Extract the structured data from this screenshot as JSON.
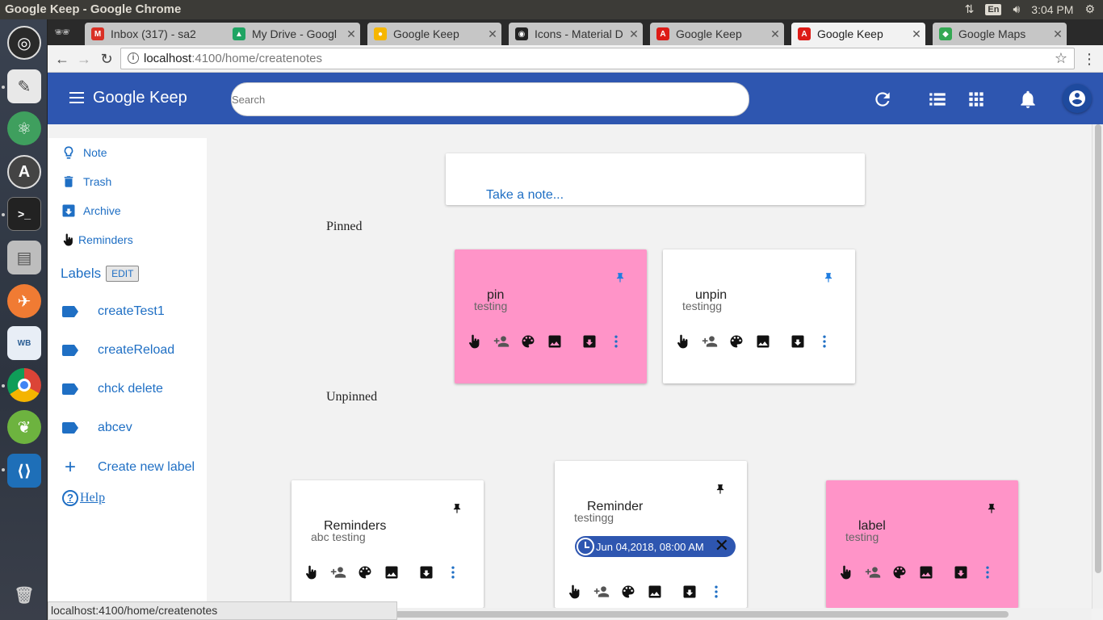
{
  "os": {
    "window_title": "Google Keep - Google Chrome",
    "lang": "En",
    "time": "3:04 PM"
  },
  "browser": {
    "tabs": [
      {
        "label": "Inbox (317) - sa2",
        "color": "#d93025"
      },
      {
        "label": "My Drive - Googl",
        "color": "#1fa463"
      },
      {
        "label": "Google Keep",
        "color": "#f6b600"
      },
      {
        "label": "Icons - Material D",
        "color": "#222222"
      },
      {
        "label": "Google Keep",
        "color": "#dd1b16"
      },
      {
        "label": "Google Keep",
        "color": "#dd1b16",
        "active": true
      },
      {
        "label": "Google Maps",
        "color": "#34a853"
      }
    ],
    "url_host": "localhost",
    "url_path": ":4100/home/createnotes",
    "status_url": "localhost:4100/home/createnotes"
  },
  "header": {
    "title": "Google Keep",
    "search_placeholder": "Search"
  },
  "sidebar": {
    "items": [
      {
        "label": "Note",
        "icon": "lightbulb-icon"
      },
      {
        "label": "Trash",
        "icon": "trash-icon"
      },
      {
        "label": "Archive",
        "icon": "archive-icon"
      },
      {
        "label": "Reminders",
        "icon": "hand-pointer-icon"
      }
    ],
    "labels_heading": "Labels",
    "edit_label": "EDIT",
    "labels": [
      "createTest1",
      "createReload",
      "chck delete",
      "abcev"
    ],
    "create_label": "Create new label",
    "help": "Help"
  },
  "main": {
    "take_note": "Take a note...",
    "pinned_heading": "Pinned",
    "unpinned_heading": "Unpinned",
    "pinned_notes": [
      {
        "title": "pin",
        "body": "testing",
        "color": "#ff94c8",
        "pin_color": "#1f7de0"
      },
      {
        "title": "unpin",
        "body": "testingg",
        "color": "#ffffff",
        "pin_color": "#1f7de0"
      }
    ],
    "unpinned_notes": [
      {
        "title": "Reminders",
        "body": "abc testing",
        "color": "#ffffff",
        "pin_color": "#111111"
      },
      {
        "title": "Reminder",
        "body": "testingg",
        "color": "#ffffff",
        "pin_color": "#111111",
        "reminder": "Jun 04,2018, 08:00 AM"
      },
      {
        "title": "label",
        "body": "testing",
        "color": "#ff94c8",
        "pin_color": "#111111"
      }
    ]
  }
}
